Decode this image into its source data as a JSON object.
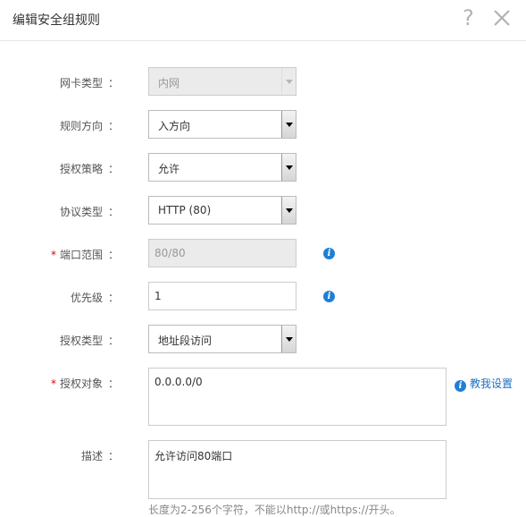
{
  "dialog": {
    "title": "编辑安全组规则",
    "help_label": "?",
    "close_icon": "close-icon"
  },
  "form": {
    "nic_type": {
      "label": "网卡类型",
      "colon": "：",
      "value": "内网",
      "disabled": true
    },
    "direction": {
      "label": "规则方向",
      "colon": "：",
      "value": "入方向"
    },
    "policy": {
      "label": "授权策略",
      "colon": "：",
      "value": "允许"
    },
    "protocol": {
      "label": "协议类型",
      "colon": "：",
      "value": "HTTP (80)"
    },
    "port_range": {
      "required_mark": "*",
      "label": "端口范围",
      "colon": "：",
      "value": "80/80",
      "disabled": true
    },
    "priority": {
      "label": "优先级",
      "colon": "：",
      "value": "1"
    },
    "auth_type": {
      "label": "授权类型",
      "colon": "：",
      "value": "地址段访问"
    },
    "auth_object": {
      "required_mark": "*",
      "label": "授权对象",
      "colon": "：",
      "value": "0.0.0.0/0",
      "help_link": "教我设置"
    },
    "description": {
      "label": "描述",
      "colon": "：",
      "value": "允许访问80端口",
      "hint": "长度为2-256个字符，不能以http://或https://开头。"
    }
  },
  "icons": {
    "info": "i",
    "info_icon_name": "info-icon"
  },
  "colors": {
    "accent": "#1e7fd6",
    "required": "#e60000",
    "disabled_bg": "#ebebeb"
  }
}
